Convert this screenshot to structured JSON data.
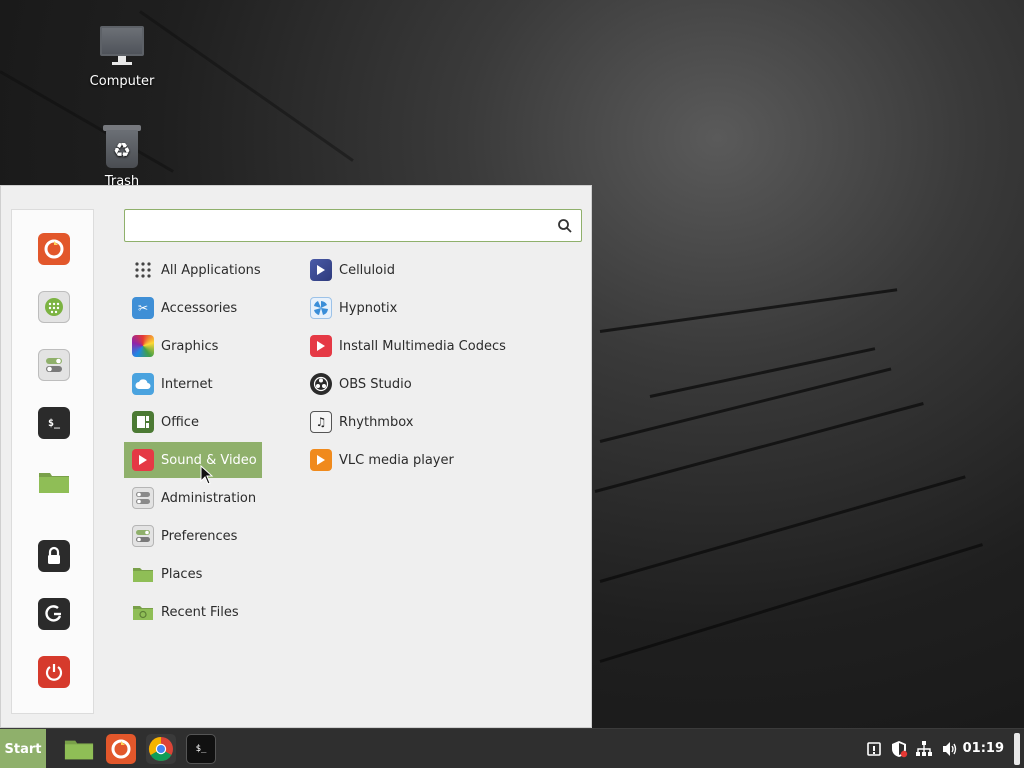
{
  "desktop": {
    "icons": [
      {
        "label": "Computer",
        "icon": "computer-icon"
      },
      {
        "label": "Trash",
        "icon": "trash-icon"
      }
    ]
  },
  "menu": {
    "search": {
      "value": "",
      "placeholder": ""
    },
    "favorites": [
      {
        "name": "firefox",
        "icon": "firefox-icon"
      },
      {
        "name": "software-manager",
        "icon": "software-manager-icon"
      },
      {
        "name": "settings",
        "icon": "settings-toggle-icon"
      },
      {
        "name": "terminal",
        "icon": "terminal-icon",
        "glyph": "$_"
      },
      {
        "name": "files",
        "icon": "folder-icon"
      },
      {
        "name": "lock-screen",
        "icon": "lock-icon"
      },
      {
        "name": "logout",
        "icon": "logout-icon"
      },
      {
        "name": "shutdown",
        "icon": "power-icon"
      }
    ],
    "categories": [
      {
        "label": "All Applications",
        "icon": "grid-icon"
      },
      {
        "label": "Accessories",
        "icon": "scissors-icon"
      },
      {
        "label": "Graphics",
        "icon": "palette-icon"
      },
      {
        "label": "Internet",
        "icon": "cloud-icon"
      },
      {
        "label": "Office",
        "icon": "office-icon"
      },
      {
        "label": "Sound & Video",
        "icon": "play-icon",
        "active": true
      },
      {
        "label": "Administration",
        "icon": "admin-toggle-icon"
      },
      {
        "label": "Preferences",
        "icon": "preferences-toggle-icon"
      },
      {
        "label": "Places",
        "icon": "folder-icon"
      },
      {
        "label": "Recent Files",
        "icon": "recent-folder-icon"
      }
    ],
    "apps": [
      {
        "label": "Celluloid",
        "icon": "celluloid-icon"
      },
      {
        "label": "Hypnotix",
        "icon": "hypnotix-icon"
      },
      {
        "label": "Install Multimedia Codecs",
        "icon": "codecs-icon"
      },
      {
        "label": "OBS Studio",
        "icon": "obs-icon"
      },
      {
        "label": "Rhythmbox",
        "icon": "rhythmbox-icon"
      },
      {
        "label": "VLC media player",
        "icon": "vlc-icon"
      }
    ]
  },
  "taskbar": {
    "start_label": "Start",
    "terminal_glyph": "$_",
    "clock": "01:19",
    "apps": [
      {
        "name": "files",
        "icon": "folder-icon"
      },
      {
        "name": "firefox",
        "icon": "firefox-icon"
      },
      {
        "name": "chrome",
        "icon": "chrome-icon"
      },
      {
        "name": "terminal",
        "icon": "terminal-icon"
      }
    ],
    "tray": [
      {
        "name": "notifications",
        "icon": "notification-icon"
      },
      {
        "name": "update-manager",
        "icon": "shield-icon"
      },
      {
        "name": "network",
        "icon": "network-icon"
      },
      {
        "name": "volume",
        "icon": "volume-icon"
      }
    ]
  },
  "colors": {
    "accent": "#8fb06b",
    "menu_bg": "#efefef",
    "panel_bg": "#2f2f2f"
  }
}
